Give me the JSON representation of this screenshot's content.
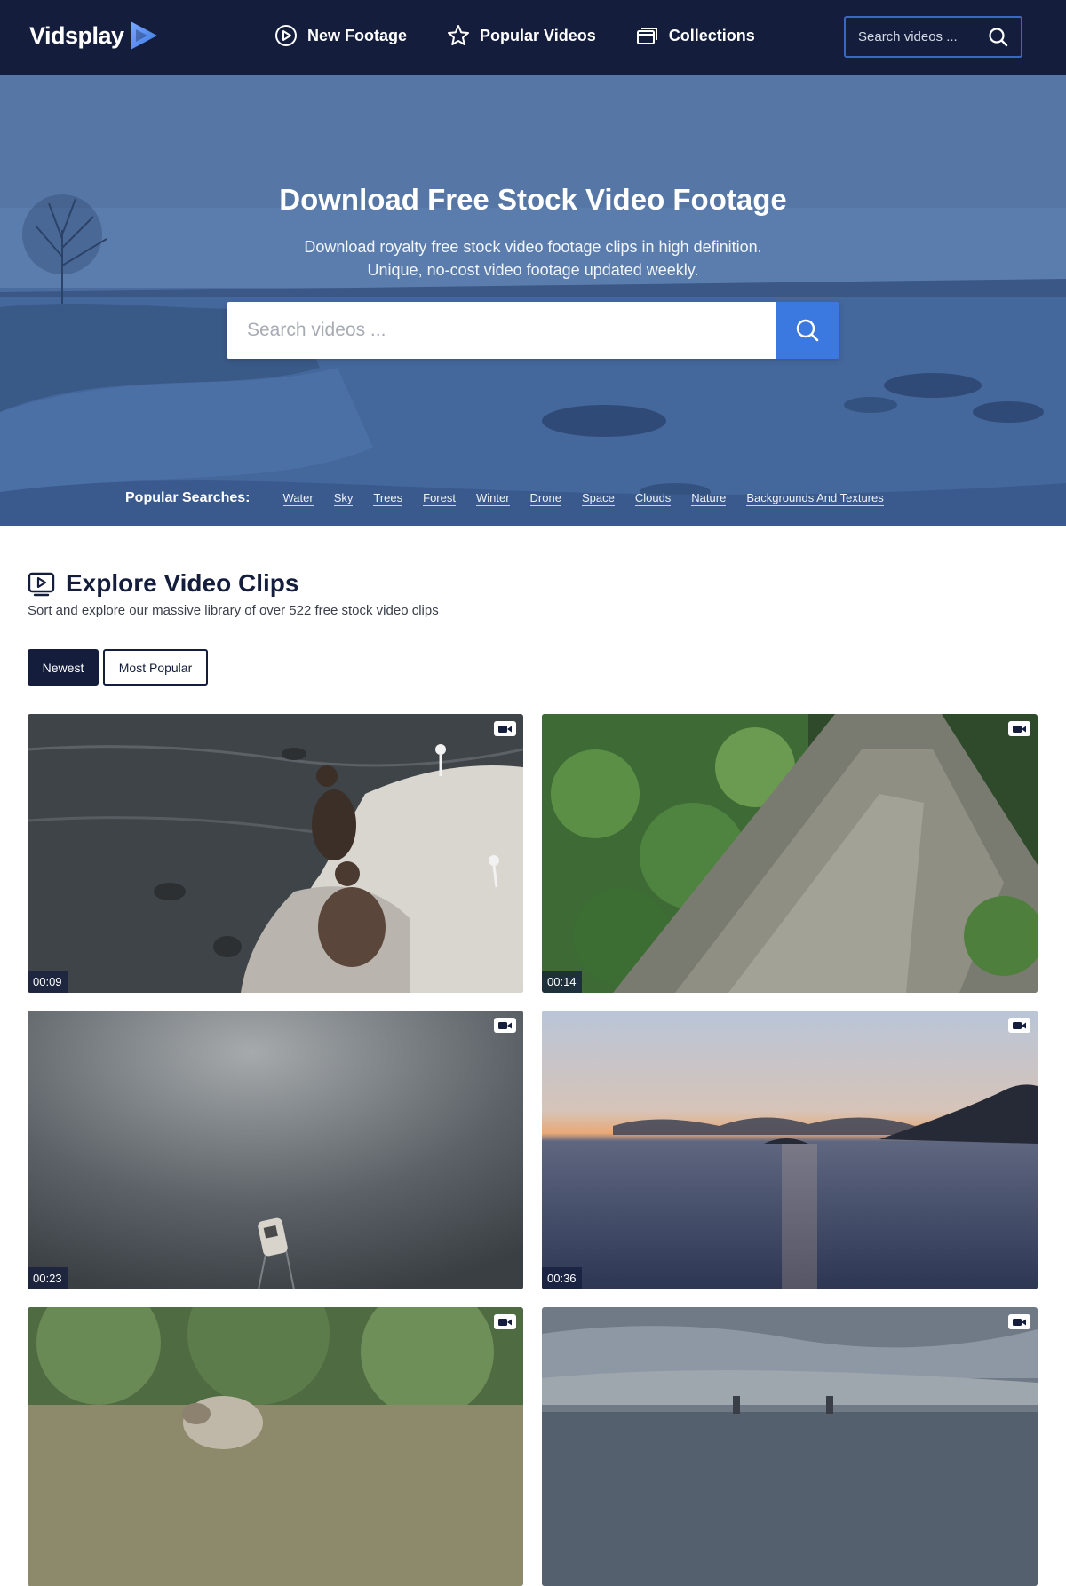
{
  "header": {
    "logo_text": "Vidsplay",
    "nav": [
      {
        "label": "New Footage",
        "icon": "play-circle-icon"
      },
      {
        "label": "Popular Videos",
        "icon": "star-icon"
      },
      {
        "label": "Collections",
        "icon": "collections-icon"
      }
    ],
    "search_placeholder": "Search videos ..."
  },
  "hero": {
    "title": "Download Free Stock Video Footage",
    "subtitle_line1": "Download royalty free stock video footage clips in high definition.",
    "subtitle_line2": "Unique, no-cost video footage updated weekly.",
    "search_placeholder": "Search videos ...",
    "popular_label": "Popular Searches:",
    "popular_searches": [
      "Water",
      "Sky",
      "Trees",
      "Forest",
      "Winter",
      "Drone",
      "Space",
      "Clouds",
      "Nature",
      "Backgrounds And Textures"
    ]
  },
  "explore": {
    "title": "Explore Video Clips",
    "description": "Sort and explore our massive library of over 522 free stock video clips",
    "sort_tabs": [
      {
        "label": "Newest",
        "active": true
      },
      {
        "label": "Most Popular",
        "active": false
      }
    ]
  },
  "clips": [
    {
      "duration": "00:09",
      "icon": "video-camera-icon"
    },
    {
      "duration": "00:14",
      "icon": "video-camera-icon"
    },
    {
      "duration": "00:23",
      "icon": "video-camera-icon"
    },
    {
      "duration": "00:36",
      "icon": "video-camera-icon"
    },
    {
      "duration": "",
      "icon": "video-camera-icon"
    },
    {
      "duration": "",
      "icon": "video-camera-icon"
    }
  ],
  "colors": {
    "header_bg": "#141e3c",
    "accent_blue": "#3b78e0",
    "text_dark": "#141e3c"
  }
}
